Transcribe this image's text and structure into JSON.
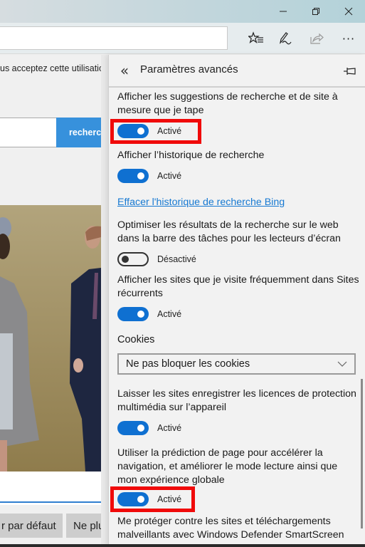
{
  "window": {
    "minimize_icon": "minimize-icon",
    "restore_icon": "restore-icon",
    "close_icon": "close-icon"
  },
  "toolbar": {
    "address_value": "",
    "icons": [
      "favorites-list-icon",
      "pen-note-icon",
      "share-icon",
      "more-icon"
    ],
    "more_label": "···"
  },
  "page": {
    "consent_text": "us acceptez cette utilisation",
    "search_button": "recherche",
    "buttons": [
      "r par défaut",
      "Ne plus"
    ],
    "image_description": "Photo of two people, a woman in grey coat and a man in navy suit"
  },
  "panel": {
    "back_label": "«",
    "title": "Paramètres avancés",
    "settings": [
      {
        "text": "Afficher les suggestions de recherche et de site à mesure que je tape",
        "state": "on",
        "state_label": "Activé",
        "highlighted": true
      },
      {
        "text": "Afficher l’historique de recherche",
        "state": "on",
        "state_label": "Activé",
        "highlighted": false
      },
      {
        "text": "Optimiser les résultats de la recherche sur le web dans la barre des tâches pour les lecteurs d’écran",
        "state": "off",
        "state_label": "Désactivé",
        "highlighted": false
      },
      {
        "text": "Afficher les sites que je visite fréquemment dans Sites récurrents",
        "state": "on",
        "state_label": "Activé",
        "highlighted": false
      },
      {
        "text": "Laisser les sites enregistrer les licences de protection multimédia sur l’appareil",
        "state": "on",
        "state_label": "Activé",
        "highlighted": false
      },
      {
        "text": "Utiliser la prédiction de page pour accélérer la navigation, et améliorer le mode lecture ainsi que mon expérience globale",
        "state": "on",
        "state_label": "Activé",
        "highlighted": true
      },
      {
        "text": "Me protéger contre les sites et téléchargements malveillants avec Windows Defender SmartScreen"
      }
    ],
    "clear_history_link": "Effacer l'historique de recherche Bing",
    "cookies_label": "Cookies",
    "cookies_select_value": "Ne pas bloquer les cookies"
  },
  "colors": {
    "accent": "#0f70d1",
    "link": "#1779d2",
    "highlight": "#f00a0a",
    "search_button": "#3791dc"
  }
}
